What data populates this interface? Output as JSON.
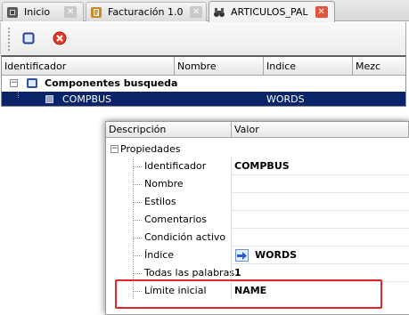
{
  "tabs": [
    {
      "label": "Inicio",
      "icon": "cube-icon",
      "active": false
    },
    {
      "label": "Facturación 1.0",
      "icon": "document-icon",
      "active": false
    },
    {
      "label": "ARTICULOS_PAL",
      "icon": "binoculars-icon",
      "active": true
    }
  ],
  "toolbar": {
    "new_icon": "new-window-icon",
    "delete_icon": "delete-icon"
  },
  "grid": {
    "columns": [
      "Identificador",
      "Nombre",
      "Indice",
      "Mezc"
    ],
    "rows": [
      {
        "identificador": "Componentes busqueda",
        "nombre": "",
        "indice": "",
        "expanded": true
      },
      {
        "identificador": "COMPBUS",
        "nombre": "",
        "indice": "WORDS",
        "selected": true
      }
    ]
  },
  "properties": {
    "columns": [
      "Descripción",
      "Valor"
    ],
    "group": "Propiedades",
    "items": [
      {
        "name": "Identificador",
        "value": "COMPBUS"
      },
      {
        "name": "Nombre",
        "value": ""
      },
      {
        "name": "Estilos",
        "value": ""
      },
      {
        "name": "Comentarios",
        "value": ""
      },
      {
        "name": "Condición activo",
        "value": ""
      },
      {
        "name": "Índice",
        "value": "WORDS",
        "icon": "arrow-right-icon"
      },
      {
        "name": "Todas las palabras",
        "value": "1"
      },
      {
        "name": "Límite inicial",
        "value": "NAME",
        "highlighted": true
      }
    ]
  },
  "colors": {
    "selection": "#0a246a",
    "highlight_box": "#e0262a",
    "close_tab": "#e2533c",
    "arrow_icon": "#2a5bd7"
  }
}
